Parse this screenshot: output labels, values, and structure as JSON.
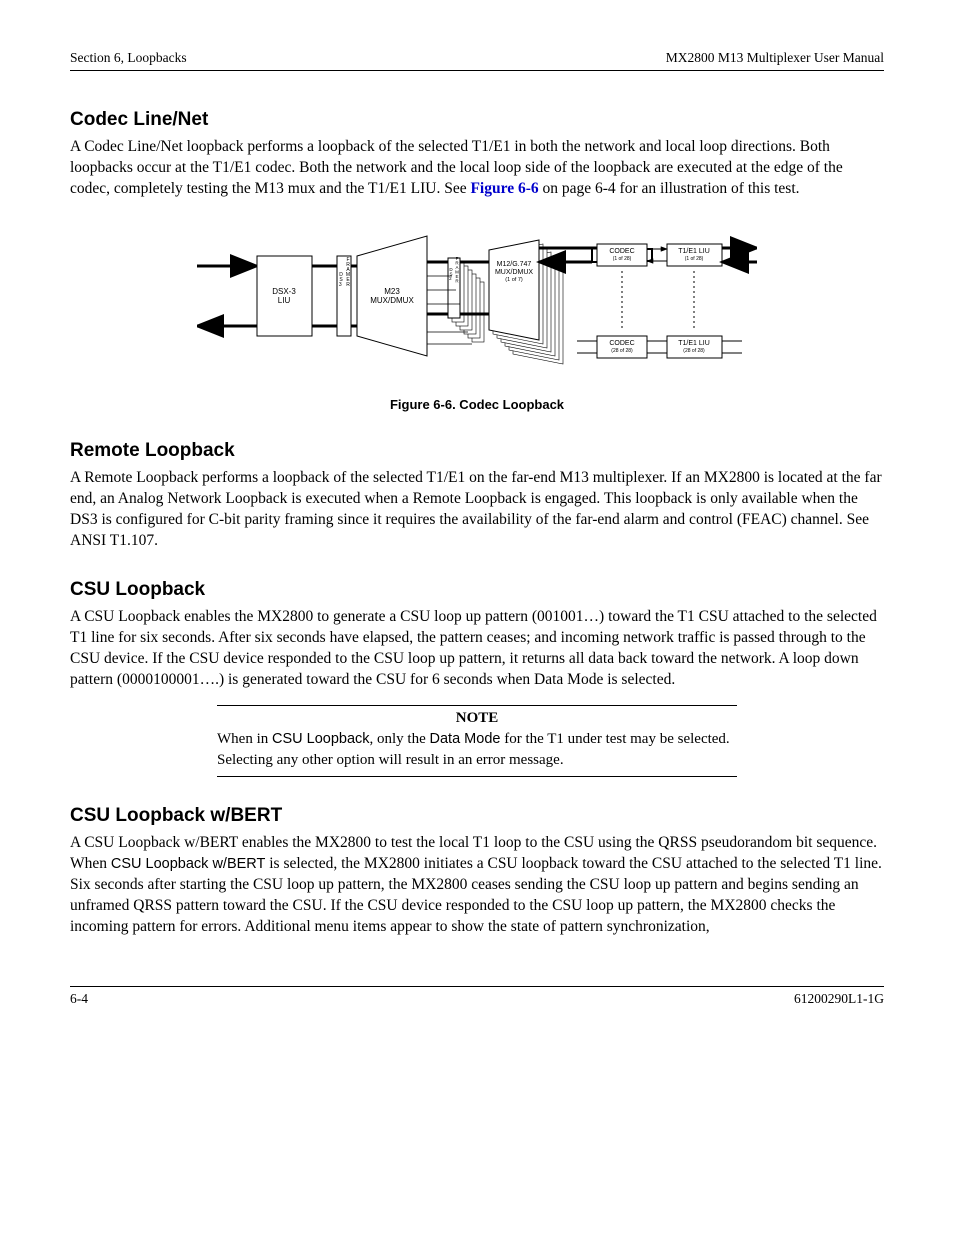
{
  "header": {
    "left": "Section 6, Loopbacks",
    "right": "MX2800 M13 Multiplexer User Manual"
  },
  "sections": {
    "codec": {
      "title": "Codec Line/Net",
      "body_pre": "A Codec Line/Net loopback performs a loopback of the selected T1/E1 in both the network and local loop directions. Both loopbacks occur at the T1/E1 codec. Both the network and the local loop side of the loopback are executed at the edge of the codec, completely testing the M13 mux and the T1/E1 LIU. See ",
      "body_link": "Figure 6-6",
      "body_post": " on page 6-4 for an illustration of this test."
    },
    "remote": {
      "title": "Remote Loopback",
      "body": "A Remote Loopback performs a loopback of the selected T1/E1 on the far-end M13 multiplexer. If an MX2800 is located at the far end, an Analog Network Loopback is executed when a Remote Loopback is engaged. This loopback is only available when the DS3 is configured for C-bit parity framing since it requires the availability of the far-end alarm and control (FEAC) channel. See ANSI T1.107."
    },
    "csu": {
      "title": "CSU Loopback",
      "body": "A CSU Loopback enables the MX2800 to generate a CSU loop up pattern (001001…) toward the T1 CSU attached to the selected T1 line for six seconds. After six seconds have elapsed, the pattern ceases; and incoming network traffic is passed through to the CSU device. If the CSU device responded to the CSU loop up pattern, it returns all data back toward the network. A loop down pattern (0000100001….) is generated toward the CSU for 6 seconds when Data Mode is selected."
    },
    "note": {
      "title": "NOTE",
      "body_pre": "When in ",
      "body_sans1": "CSU Loopback",
      "body_mid": ", only the ",
      "body_sans2": "Data Mode",
      "body_post": " for the T1 under test may be selected. Selecting any other option will result in an error message."
    },
    "csubert": {
      "title": "CSU Loopback w/BERT",
      "body_pre": "A CSU Loopback w/BERT enables the MX2800 to test the local T1 loop to the CSU using the QRSS pseudorandom bit sequence. When ",
      "body_sans": "CSU Loopback w/BERT",
      "body_post": " is selected, the MX2800 initiates a CSU loopback toward the CSU attached to the selected T1 line. Six seconds after starting the CSU loop up pattern, the MX2800 ceases sending the CSU loop up pattern and begins sending an unframed QRSS pattern toward the CSU. If the CSU device responded to the CSU loop up pattern, the MX2800 checks the incoming pattern for errors. Additional menu items appear to show the state of pattern synchronization,"
    }
  },
  "figure": {
    "caption": "Figure 6-6.  Codec Loopback",
    "labels": {
      "dsx3_liu": "DSX-3 LIU",
      "ds3_framer": "DS3 FRAMER",
      "m23": "M23 MUX/DMUX",
      "ds2_framer": "DS2 FRAMER",
      "m12": "M12/G.747 MUX/DMUX",
      "m12_sub": "(1 of 7)",
      "codec1": "CODEC",
      "codec1_sub": "(1 of 28)",
      "codec28": "CODEC",
      "codec28_sub": "(28 of 28)",
      "liu1": "T1/E1 LIU",
      "liu1_sub": "(1 of 28)",
      "liu28": "T1/E1 LIU",
      "liu28_sub": "(28 of 28)"
    }
  },
  "footer": {
    "left": "6-4",
    "right": "61200290L1-1G"
  }
}
